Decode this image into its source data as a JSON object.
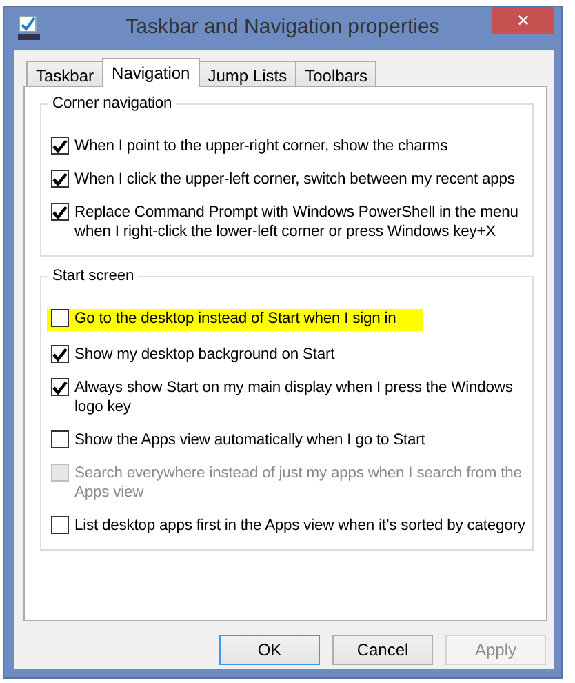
{
  "window": {
    "title": "Taskbar and Navigation properties",
    "close": "✕"
  },
  "tabs": [
    {
      "label": "Taskbar",
      "selected": false
    },
    {
      "label": "Navigation",
      "selected": true
    },
    {
      "label": "Jump Lists",
      "selected": false
    },
    {
      "label": "Toolbars",
      "selected": false
    }
  ],
  "groups": [
    {
      "title": "Corner navigation",
      "items": [
        {
          "label": "When I point to the upper-right corner, show the charms",
          "checked": true,
          "disabled": false,
          "highlighted": false
        },
        {
          "label": "When I click the upper-left corner, switch between my recent apps",
          "checked": true,
          "disabled": false,
          "highlighted": false
        },
        {
          "label": "Replace Command Prompt with Windows PowerShell in the menu when I right-click the lower-left corner or press Windows key+X",
          "checked": true,
          "disabled": false,
          "highlighted": false
        }
      ]
    },
    {
      "title": "Start screen",
      "items": [
        {
          "label": "Go to the desktop instead of Start when I sign in",
          "checked": false,
          "disabled": false,
          "highlighted": true
        },
        {
          "label": "Show my desktop background on Start",
          "checked": true,
          "disabled": false,
          "highlighted": false
        },
        {
          "label": "Always show Start on my main display when I press the Windows logo key",
          "checked": true,
          "disabled": false,
          "highlighted": false
        },
        {
          "label": "Show the Apps view automatically when I go to Start",
          "checked": false,
          "disabled": false,
          "highlighted": false
        },
        {
          "label": "Search everywhere instead of just my apps when I search from the Apps view",
          "checked": false,
          "disabled": true,
          "highlighted": false
        },
        {
          "label": "List desktop apps first in the Apps view when it’s sorted by category",
          "checked": false,
          "disabled": false,
          "highlighted": false
        }
      ]
    }
  ],
  "buttons": [
    {
      "label": "OK",
      "default": true,
      "disabled": false
    },
    {
      "label": "Cancel",
      "default": false,
      "disabled": false
    },
    {
      "label": "Apply",
      "default": false,
      "disabled": true
    }
  ]
}
